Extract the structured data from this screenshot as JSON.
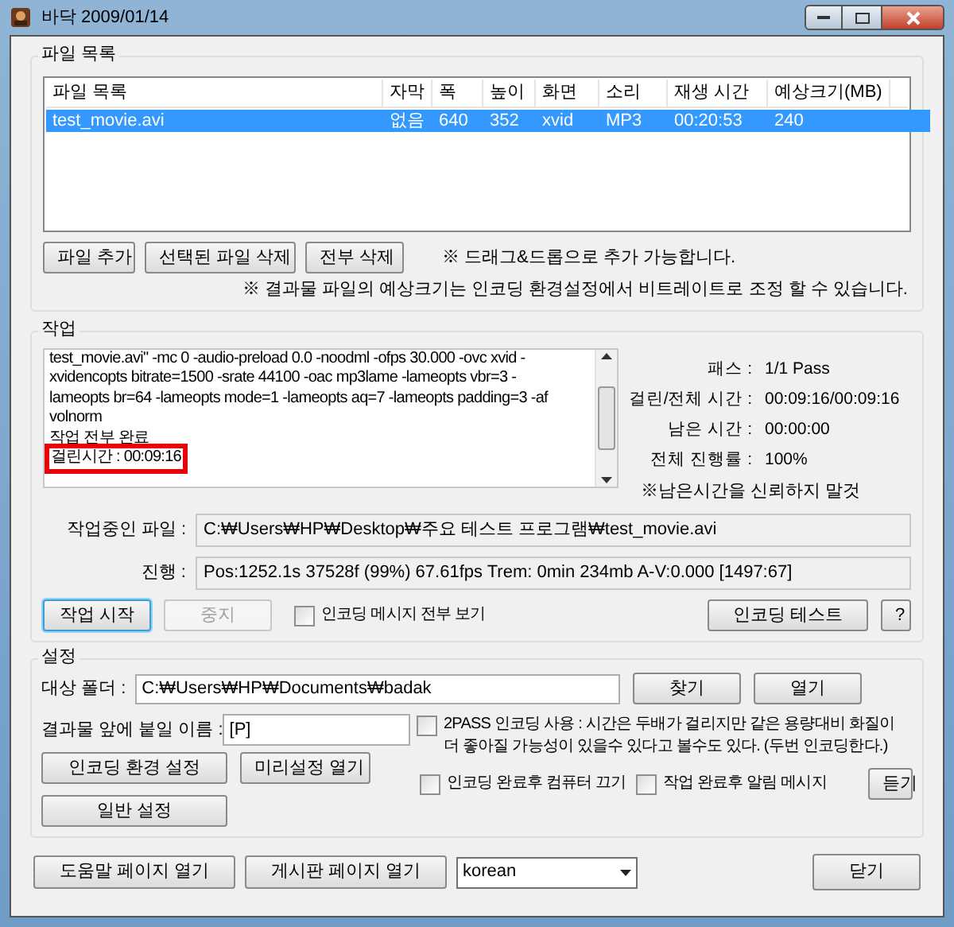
{
  "window": {
    "title": "바닥 2009/01/14"
  },
  "file_list": {
    "group_title": "파일 목록",
    "columns": [
      "파일 목록",
      "자막",
      "폭",
      "높이",
      "화면",
      "소리",
      "재생 시간",
      "예상크기(MB)"
    ],
    "rows": [
      {
        "cells": [
          "test_movie.avi",
          "없음",
          "640",
          "352",
          "xvid",
          "MP3",
          "00:20:53",
          "240"
        ],
        "selected": true
      }
    ],
    "buttons": [
      "파일 추가",
      "선택된 파일 삭제",
      "전부 삭제"
    ],
    "notes": [
      "※ 드래그&드롭으로 추가 가능합니다.",
      "※ 결과물 파일의 예상크기는 인코딩 환경설정에서 비트레이트로 조정 할 수 있습니다."
    ]
  },
  "job": {
    "group_title": "작업",
    "log_lines": [
      {
        "text": "test_movie.avi\" -mc 0 -audio-preload 0.0 -noodml -ofps 30.000 -ovc xvid -",
        "highlighted": false
      },
      {
        "text": "xvidencopts bitrate=1500 -srate 44100 -oac mp3lame -lameopts vbr=3  -",
        "highlighted": false
      },
      {
        "text": "lameopts br=64 -lameopts mode=1 -lameopts aq=7 -lameopts padding=3 -af",
        "highlighted": false
      },
      {
        "text": "volnorm",
        "highlighted": false
      },
      {
        "text": "작업 전부 완료",
        "highlighted": false
      },
      {
        "text": "걸린시간 : 00:09:16",
        "highlighted": true
      }
    ],
    "stats": [
      {
        "label": "패스 :",
        "value": "1/1 Pass"
      },
      {
        "label": "걸린/전체 시간 :",
        "value": "00:09:16/00:09:16"
      },
      {
        "label": "남은 시간 :",
        "value": "00:00:00"
      },
      {
        "label": "전체 진행률 :",
        "value": "100%"
      }
    ],
    "stats_note": "※남은시간을 신뢰하지 말것",
    "fields": [
      {
        "label": "작업중인 파일 :",
        "value": "C:₩Users₩HP₩Desktop₩주요 테스트 프로그램₩test_movie.avi"
      },
      {
        "label": "진행 :",
        "value": "Pos:1252.1s  37528f (99%) 67.61fps Trem:   0min 234mb  A-V:0.000 [1497:67]"
      }
    ],
    "buttons": [
      {
        "label": "작업 시작",
        "disabled": false,
        "focused": true
      },
      {
        "label": "중지",
        "disabled": true,
        "focused": false
      }
    ],
    "show_all_messages": {
      "label": "인코딩 메시지 전부 보기",
      "checked": false
    },
    "test_button": "인코딩 테스트",
    "help_button": "?"
  },
  "settings": {
    "group_title": "설정",
    "target_folder": {
      "label": "대상 폴더 :",
      "value": "C:₩Users₩HP₩Documents₩badak"
    },
    "folder_buttons": [
      "찾기",
      "열기"
    ],
    "prefix": {
      "label": "결과물 앞에 붙일 이름 :",
      "value": "[P]"
    },
    "two_pass": {
      "label": "2PASS 인코딩 사용 : 시간은 두배가 걸리지만 같은 용량대비 화질이 더 좋아질 가능성이 있을수 있다고 볼수도 있다. (두번 인코딩한다.)",
      "checked": false
    },
    "buttons": [
      "인코딩 환경 설정",
      "미리설정 열기",
      "일반 설정"
    ],
    "shutdown": {
      "label": "인코딩 완료후 컴퓨터 끄기",
      "checked": false
    },
    "notify": {
      "label": "작업 완료후 알림 메시지",
      "checked": false
    },
    "listen_button": "듣기"
  },
  "footer": {
    "buttons": [
      "도움말 페이지 열기",
      "게시판 페이지 열기"
    ],
    "language": "korean",
    "close_button": "닫기"
  }
}
